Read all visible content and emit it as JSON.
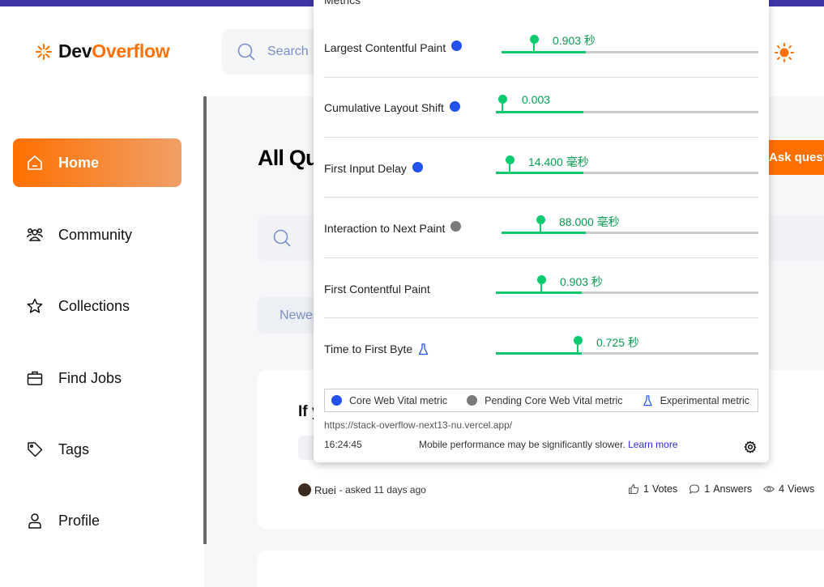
{
  "header": {
    "logo_dev": "Dev",
    "logo_overflow": "Overflow",
    "search_placeholder": "Search"
  },
  "sidebar": {
    "items": [
      {
        "label": "Home",
        "icon": "home-icon",
        "active": true
      },
      {
        "label": "Community",
        "icon": "users-icon"
      },
      {
        "label": "Collections",
        "icon": "star-icon"
      },
      {
        "label": "Find Jobs",
        "icon": "suitcase-icon"
      },
      {
        "label": "Tags",
        "icon": "tag-icon"
      },
      {
        "label": "Profile",
        "icon": "user-icon"
      }
    ]
  },
  "main": {
    "title": "All Qu",
    "ask_button": "Ask questi",
    "filter_chip": "Newes",
    "question": {
      "title_partial": "If y",
      "author": "Ruei",
      "asked": "- asked 11 days ago",
      "votes_num": "1",
      "votes_label": "Votes",
      "answers_num": "1",
      "answers_label": "Answers",
      "views_num": "4",
      "views_label": "Views"
    }
  },
  "vitals": {
    "heading": "Metrics",
    "metrics": [
      {
        "label": "Largest Contentful Paint",
        "marker": "core",
        "value": "0.903 秒"
      },
      {
        "label": "Cumulative Layout Shift",
        "marker": "core",
        "value": "0.003"
      },
      {
        "label": "First Input Delay",
        "marker": "core",
        "value": "14.400 毫秒"
      },
      {
        "label": "Interaction to Next Paint",
        "marker": "pending",
        "value": "88.000 毫秒"
      },
      {
        "label": "First Contentful Paint",
        "marker": "none",
        "value": "0.903 秒"
      },
      {
        "label": "Time to First Byte",
        "marker": "experimental",
        "value": "0.725 秒"
      }
    ],
    "legend": {
      "core": "Core Web Vital metric",
      "pending": "Pending Core Web Vital metric",
      "experimental": "Experimental metric"
    },
    "url": "https://stack-overflow-next13-nu.vercel.app/",
    "time": "16:24:45",
    "note": "Mobile performance may be significantly slower.",
    "learn_more": "Learn more"
  },
  "colors": {
    "accent": "#ff7000",
    "good": "#12c76e",
    "core": "#2251ee",
    "pending": "#7a7a7a"
  }
}
